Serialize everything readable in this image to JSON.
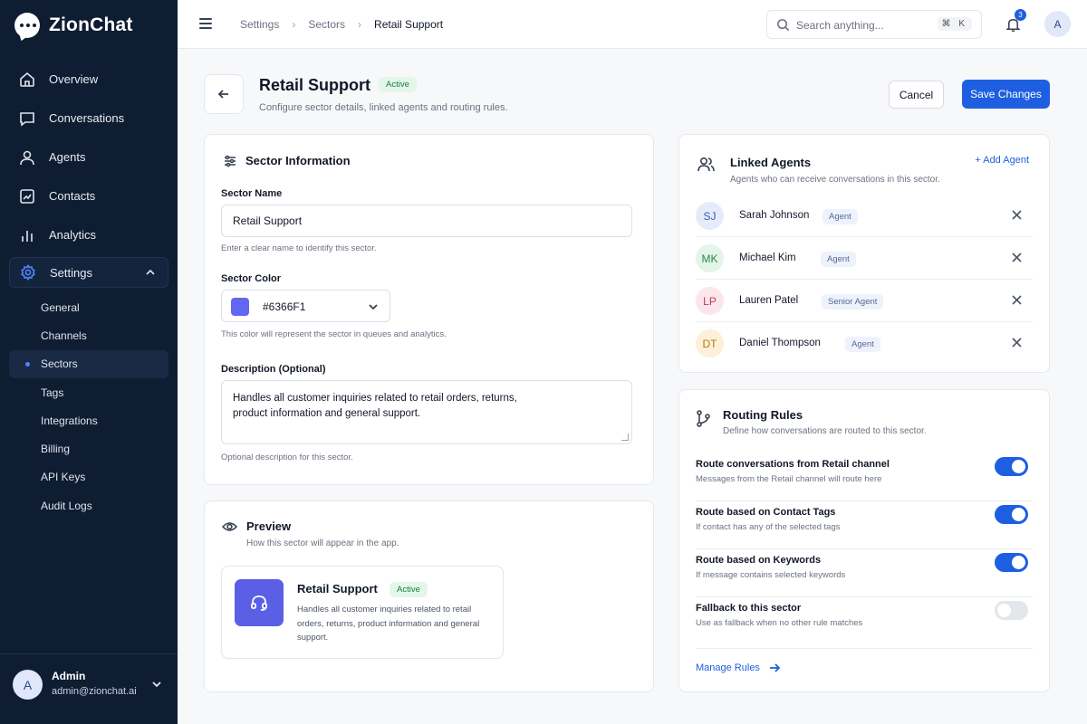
{
  "app": {
    "name": "ZionChat"
  },
  "sidebar": {
    "nav": [
      {
        "label": "Overview",
        "icon": "home-icon"
      },
      {
        "label": "Conversations",
        "icon": "chat-icon"
      },
      {
        "label": "Agents",
        "icon": "user-icon"
      },
      {
        "label": "Contacts",
        "icon": "contacts-icon"
      },
      {
        "label": "Analytics",
        "icon": "bar-chart-icon"
      }
    ],
    "settings_label": "Settings",
    "sub_items": [
      "General",
      "Channels",
      "Sectors",
      "Tags",
      "Integrations",
      "Billing",
      "API Keys",
      "Audit Logs"
    ],
    "active_sub": "Sectors",
    "user": {
      "initial": "A",
      "name": "Admin",
      "email": "admin@zionchat.ai"
    }
  },
  "topbar": {
    "breadcrumbs": [
      "Settings",
      "Sectors",
      "Retail Support"
    ],
    "search_placeholder": "Search anything...",
    "search_shortcut": "⌘ K",
    "notification_count": "3",
    "avatar_initial": "A"
  },
  "header": {
    "title": "Retail Support",
    "status": "Active",
    "subtitle": "Configure sector details, linked agents and routing rules.",
    "cancel_label": "Cancel",
    "save_label": "Save Changes"
  },
  "sector_info": {
    "title": "Sector Information",
    "name_label": "Sector Name",
    "name_value": "Retail Support",
    "name_help": "Enter a clear name to identify this sector.",
    "color_label": "Sector Color",
    "color_value": "#6366F1",
    "color_help": "This color will represent the sector in queues and analytics.",
    "desc_label": "Description (Optional)",
    "desc_line1": "Handles all customer inquiries related to retail orders, returns,",
    "desc_line2": "product information and general support.",
    "desc_help": "Optional description for this sector."
  },
  "preview": {
    "title": "Preview",
    "subtitle": "How this sector will appear in the app.",
    "name": "Retail Support",
    "status": "Active",
    "description": "Handles all customer inquiries related to retail orders, returns, product information and general support."
  },
  "linked_agents": {
    "title": "Linked Agents",
    "subtitle": "Agents who can receive conversations in this sector.",
    "add_label": "+ Add Agent",
    "agents": [
      {
        "initials": "SJ",
        "name": "Sarah Johnson",
        "role": "Agent",
        "bg": "#e6ebfa",
        "fg": "#3b5bb5"
      },
      {
        "initials": "MK",
        "name": "Michael Kim",
        "role": "Agent",
        "bg": "#e3f5e8",
        "fg": "#2a8a4a"
      },
      {
        "initials": "LP",
        "name": "Lauren Patel",
        "role": "Senior Agent",
        "bg": "#fbe6ec",
        "fg": "#c0395e"
      },
      {
        "initials": "DT",
        "name": "Daniel Thompson",
        "role": "Agent",
        "bg": "#fcf0d8",
        "fg": "#b07a14"
      }
    ]
  },
  "routing": {
    "title": "Routing Rules",
    "subtitle": "Define how conversations are routed to this sector.",
    "rules": [
      {
        "title": "Route conversations from Retail channel",
        "desc": "Messages from the Retail channel will route here",
        "on": true
      },
      {
        "title": "Route based on Contact Tags",
        "desc": "If contact has any of the selected tags",
        "on": true
      },
      {
        "title": "Route based on Keywords",
        "desc": "If message contains selected keywords",
        "on": true
      },
      {
        "title": "Fallback to this sector",
        "desc": "Use as fallback when no other rule matches",
        "on": false
      }
    ],
    "manage_label": "Manage Rules"
  },
  "colors": {
    "accent": "#1d5fe0",
    "sidebar_bg": "#0f1d33",
    "success": "#16813d"
  }
}
